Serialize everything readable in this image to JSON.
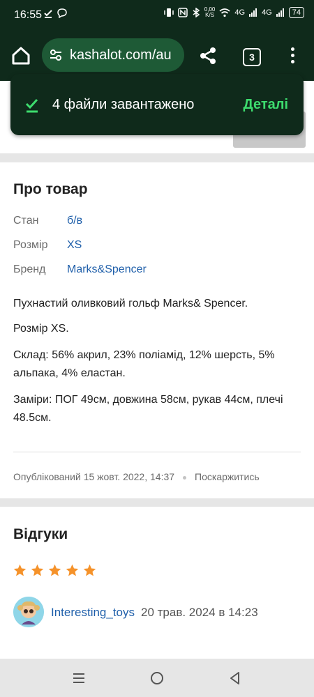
{
  "status_bar": {
    "time": "16:55",
    "net_speed": "0,00",
    "net_unit": "K/S",
    "network_1": "4G",
    "network_2": "4G",
    "battery": "74"
  },
  "browser": {
    "url": "kashalot.com/au",
    "tab_count": "3"
  },
  "snackbar": {
    "message": "4 файли завантажено",
    "action": "Деталі"
  },
  "about": {
    "title": "Про товар",
    "attributes": [
      {
        "label": "Стан",
        "value": "б/в"
      },
      {
        "label": "Розмір",
        "value": "XS"
      },
      {
        "label": "Бренд",
        "value": "Marks&Spencer"
      }
    ],
    "description": [
      "Пухнастий оливковий гольф Marks& Spencer.",
      "Розмір XS.",
      "Склад: 56% акрил, 23% поліамід, 12% шерсть, 5% альпака, 4% еластан.",
      "Заміри: ПОГ 49см, довжина 58см, рукав 44см, плечі 48.5см."
    ],
    "published": "Опублікований 15 жовт. 2022, 14:37",
    "report": "Поскаржитись"
  },
  "reviews": {
    "title": "Відгуки",
    "rating": 5,
    "reviewer": "Interesting_toys",
    "date": "20 трав. 2024 в 14:23"
  },
  "colors": {
    "browser_bg": "#0f2a1b",
    "url_bar": "#1e5a36",
    "accent_green": "#3ddc6e",
    "link_blue": "#1f5faa",
    "star": "#f5922a"
  }
}
